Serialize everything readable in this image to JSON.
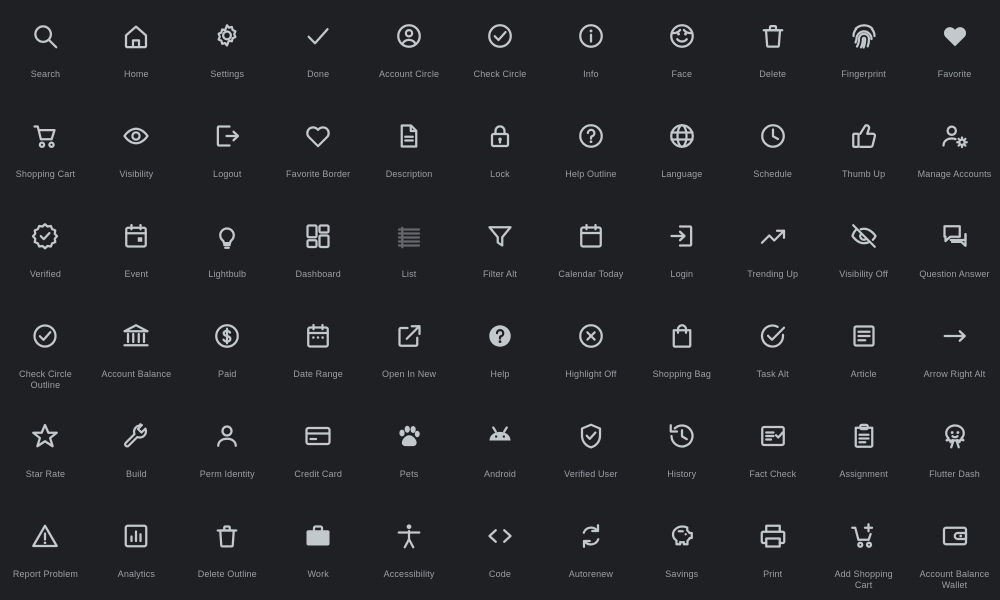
{
  "gallery": {
    "background_color": "#1e2024",
    "icon_color": "#c3c8cd",
    "label_color": "#9a9fa5",
    "columns": 11,
    "rows": 6,
    "total_icons": 66,
    "icons": [
      {
        "label": "Search",
        "icon": "search-icon"
      },
      {
        "label": "Home",
        "icon": "home-icon"
      },
      {
        "label": "Settings",
        "icon": "settings-gear-icon"
      },
      {
        "label": "Done",
        "icon": "check-icon"
      },
      {
        "label": "Account Circle",
        "icon": "account-circle-icon"
      },
      {
        "label": "Check Circle",
        "icon": "check-circle-icon"
      },
      {
        "label": "Info",
        "icon": "info-icon"
      },
      {
        "label": "Face",
        "icon": "face-icon"
      },
      {
        "label": "Delete",
        "icon": "delete-trash-icon"
      },
      {
        "label": "Fingerprint",
        "icon": "fingerprint-icon"
      },
      {
        "label": "Favorite",
        "icon": "heart-filled-icon"
      },
      {
        "label": "Shopping Cart",
        "icon": "shopping-cart-icon"
      },
      {
        "label": "Visibility",
        "icon": "eye-icon"
      },
      {
        "label": "Logout",
        "icon": "logout-icon"
      },
      {
        "label": "Favorite Border",
        "icon": "heart-outline-icon"
      },
      {
        "label": "Description",
        "icon": "description-document-icon"
      },
      {
        "label": "Lock",
        "icon": "lock-icon"
      },
      {
        "label": "Help Outline",
        "icon": "help-outline-icon"
      },
      {
        "label": "Language",
        "icon": "globe-icon"
      },
      {
        "label": "Schedule",
        "icon": "clock-icon"
      },
      {
        "label": "Thumb Up",
        "icon": "thumb-up-icon"
      },
      {
        "label": "Manage Accounts",
        "icon": "manage-accounts-icon"
      },
      {
        "label": "Verified",
        "icon": "verified-badge-icon"
      },
      {
        "label": "Event",
        "icon": "event-calendar-icon"
      },
      {
        "label": "Lightbulb",
        "icon": "lightbulb-icon"
      },
      {
        "label": "Dashboard",
        "icon": "dashboard-icon"
      },
      {
        "label": "List",
        "icon": "list-icon",
        "dim": true
      },
      {
        "label": "Filter Alt",
        "icon": "filter-alt-icon"
      },
      {
        "label": "Calendar Today",
        "icon": "calendar-today-icon"
      },
      {
        "label": "Login",
        "icon": "login-icon"
      },
      {
        "label": "Trending Up",
        "icon": "trending-up-icon"
      },
      {
        "label": "Visibility Off",
        "icon": "eye-off-icon"
      },
      {
        "label": "Question Answer",
        "icon": "question-answer-icon"
      },
      {
        "label": "Check Circle Outline",
        "icon": "check-circle-outline-icon"
      },
      {
        "label": "Account Balance",
        "icon": "account-balance-bank-icon"
      },
      {
        "label": "Paid",
        "icon": "paid-dollar-icon"
      },
      {
        "label": "Date Range",
        "icon": "date-range-icon"
      },
      {
        "label": "Open In New",
        "icon": "open-in-new-icon"
      },
      {
        "label": "Help",
        "icon": "help-filled-icon"
      },
      {
        "label": "Highlight Off",
        "icon": "highlight-off-icon"
      },
      {
        "label": "Shopping Bag",
        "icon": "shopping-bag-icon"
      },
      {
        "label": "Task Alt",
        "icon": "task-alt-icon"
      },
      {
        "label": "Article",
        "icon": "article-icon"
      },
      {
        "label": "Arrow Right Alt",
        "icon": "arrow-right-alt-icon"
      },
      {
        "label": "Star Rate",
        "icon": "star-outline-icon"
      },
      {
        "label": "Build",
        "icon": "build-wrench-icon"
      },
      {
        "label": "Perm Identity",
        "icon": "perm-identity-person-icon"
      },
      {
        "label": "Credit Card",
        "icon": "credit-card-icon"
      },
      {
        "label": "Pets",
        "icon": "pets-paw-icon"
      },
      {
        "label": "Android",
        "icon": "android-icon"
      },
      {
        "label": "Verified User",
        "icon": "verified-user-shield-icon"
      },
      {
        "label": "History",
        "icon": "history-icon"
      },
      {
        "label": "Fact Check",
        "icon": "fact-check-icon"
      },
      {
        "label": "Assignment",
        "icon": "assignment-clipboard-icon"
      },
      {
        "label": "Flutter Dash",
        "icon": "flutter-dash-icon"
      },
      {
        "label": "Report Problem",
        "icon": "report-problem-warning-icon"
      },
      {
        "label": "Analytics",
        "icon": "analytics-icon"
      },
      {
        "label": "Delete Outline",
        "icon": "delete-outline-icon"
      },
      {
        "label": "Work",
        "icon": "work-briefcase-icon"
      },
      {
        "label": "Accessibility",
        "icon": "accessibility-icon"
      },
      {
        "label": "Code",
        "icon": "code-icon"
      },
      {
        "label": "Autorenew",
        "icon": "autorenew-icon"
      },
      {
        "label": "Savings",
        "icon": "savings-piggy-bank-icon"
      },
      {
        "label": "Print",
        "icon": "print-icon"
      },
      {
        "label": "Add Shopping Cart",
        "icon": "add-shopping-cart-icon"
      },
      {
        "label": "Account Balance Wallet",
        "icon": "account-balance-wallet-icon"
      }
    ]
  }
}
